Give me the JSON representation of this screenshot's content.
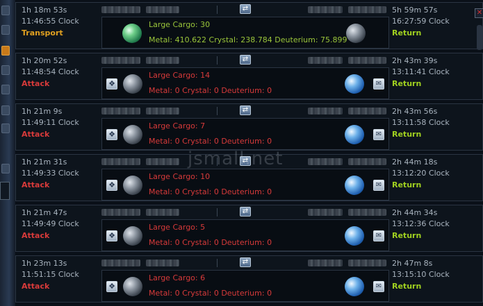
{
  "watermark": "jsmall.net",
  "icons": {
    "reverse": "reverse-arrow-icon",
    "expedition": "espionage-icon",
    "message": "envelope-icon",
    "close": "close-icon"
  },
  "colors": {
    "attack": "#d83a3a",
    "transport": "#e0a020",
    "return": "#a0d020",
    "transport_text": "#9ac53a"
  },
  "fleets": [
    {
      "time_left": "1h 18m 53s",
      "arrival_clock": "11:46:55 Clock",
      "mission": "Transport",
      "mission_type": "transport",
      "cargo": "Large Cargo: 30",
      "resources": "Metal: 410.622 Crystal: 238.784 Deuterium: 75.899",
      "return_time": "5h 59m 57s",
      "return_clock": "16:27:59 Clock",
      "return_label": "Return",
      "origin": "green",
      "dest": "moon"
    },
    {
      "time_left": "1h 20m 52s",
      "arrival_clock": "11:48:54 Clock",
      "mission": "Attack",
      "mission_type": "attack",
      "cargo": "Large Cargo: 14",
      "resources": "Metal: 0 Crystal: 0 Deuterium: 0",
      "return_time": "2h 43m 39s",
      "return_clock": "13:11:41 Clock",
      "return_label": "Return",
      "origin": "moon",
      "dest": "blue"
    },
    {
      "time_left": "1h 21m 9s",
      "arrival_clock": "11:49:11 Clock",
      "mission": "Attack",
      "mission_type": "attack",
      "cargo": "Large Cargo: 7",
      "resources": "Metal: 0 Crystal: 0 Deuterium: 0",
      "return_time": "2h 43m 56s",
      "return_clock": "13:11:58 Clock",
      "return_label": "Return",
      "origin": "moon",
      "dest": "blue"
    },
    {
      "time_left": "1h 21m 31s",
      "arrival_clock": "11:49:33 Clock",
      "mission": "Attack",
      "mission_type": "attack",
      "cargo": "Large Cargo: 10",
      "resources": "Metal: 0 Crystal: 0 Deuterium: 0",
      "return_time": "2h 44m 18s",
      "return_clock": "13:12:20 Clock",
      "return_label": "Return",
      "origin": "moon",
      "dest": "blue"
    },
    {
      "time_left": "1h 21m 47s",
      "arrival_clock": "11:49:49 Clock",
      "mission": "Attack",
      "mission_type": "attack",
      "cargo": "Large Cargo: 5",
      "resources": "Metal: 0 Crystal: 0 Deuterium: 0",
      "return_time": "2h 44m 34s",
      "return_clock": "13:12:36 Clock",
      "return_label": "Return",
      "origin": "moon",
      "dest": "blue"
    },
    {
      "time_left": "1h 23m 13s",
      "arrival_clock": "11:51:15 Clock",
      "mission": "Attack",
      "mission_type": "attack",
      "cargo": "Large Cargo: 6",
      "resources": "Metal: 0 Crystal: 0 Deuterium: 0",
      "return_time": "2h 47m 8s",
      "return_clock": "13:15:10 Clock",
      "return_label": "Return",
      "origin": "moon",
      "dest": "blue"
    }
  ]
}
